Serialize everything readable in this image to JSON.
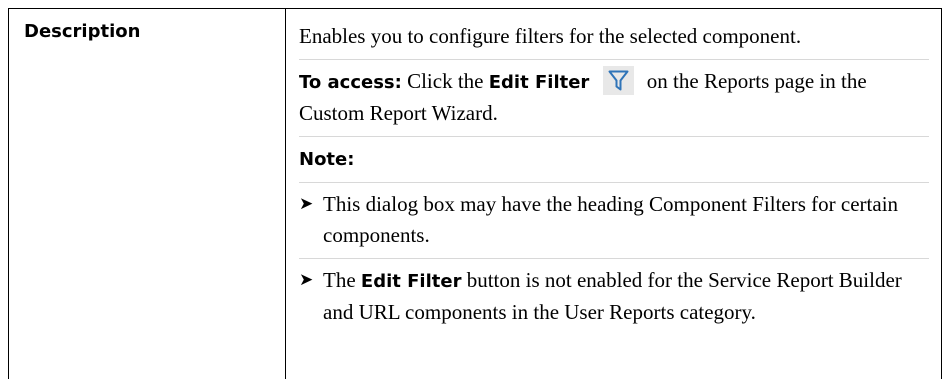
{
  "label": "Description",
  "description_text": "Enables you to configure filters for the selected component.",
  "access": {
    "lead": "To access:",
    "text_before": " Click the ",
    "button_name": "Edit Filter",
    "text_after": " on the Reports page in the Custom Report Wizard."
  },
  "note_heading": "Note:",
  "bullets": [
    {
      "text": "This dialog box may have the heading Component Filters for certain components."
    },
    {
      "bold": "Edit Filter",
      "before": "The ",
      "after": " button is not enabled for the Service Report Builder and URL components in the User Reports category."
    }
  ],
  "bullet_glyph": "➤",
  "icons": {
    "filter": "filter-funnel-icon"
  },
  "colors": {
    "icon_blue": "#2f74b8",
    "icon_bg": "#e8e8e8",
    "divider": "#d8d8d8"
  }
}
